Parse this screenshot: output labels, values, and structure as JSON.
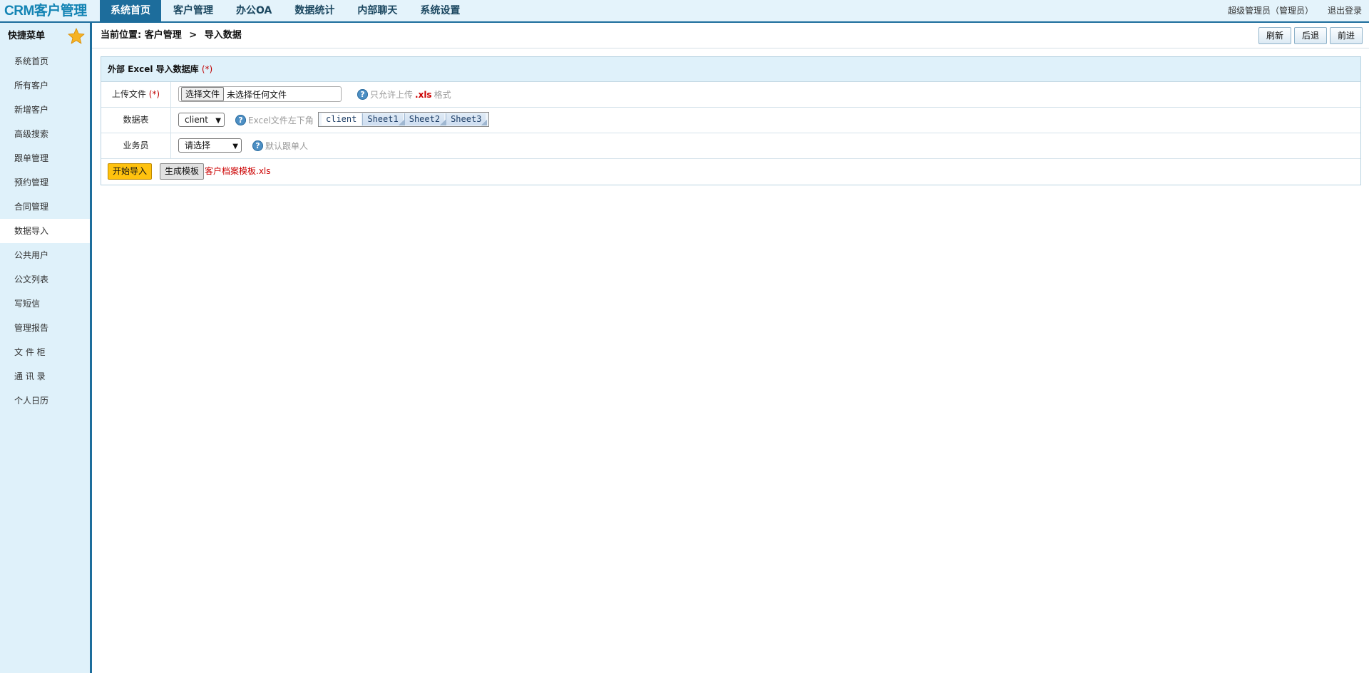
{
  "app": {
    "logo": "CRM客户管理"
  },
  "nav": {
    "tabs": [
      {
        "label": "系统首页",
        "active": true
      },
      {
        "label": "客户管理",
        "active": false
      },
      {
        "label": "办公OA",
        "active": false
      },
      {
        "label": "数据统计",
        "active": false
      },
      {
        "label": "内部聊天",
        "active": false
      },
      {
        "label": "系统设置",
        "active": false
      }
    ]
  },
  "user": {
    "name": "超级管理员（管理员）",
    "logout": "退出登录"
  },
  "sidebar": {
    "title": "快捷菜单",
    "items": [
      {
        "label": "系统首页",
        "active": false
      },
      {
        "label": "所有客户",
        "active": false
      },
      {
        "label": "新增客户",
        "active": false
      },
      {
        "label": "高级搜索",
        "active": false
      },
      {
        "label": "跟单管理",
        "active": false
      },
      {
        "label": "预约管理",
        "active": false
      },
      {
        "label": "合同管理",
        "active": false
      },
      {
        "label": "数据导入",
        "active": true
      },
      {
        "label": "公共用户",
        "active": false
      },
      {
        "label": "公文列表",
        "active": false
      },
      {
        "label": "写短信",
        "active": false
      },
      {
        "label": "管理报告",
        "active": false
      },
      {
        "label": "文 件 柜",
        "active": false
      },
      {
        "label": "通 讯 录",
        "active": false
      },
      {
        "label": "个人日历",
        "active": false
      }
    ]
  },
  "breadcrumb": {
    "prefix": "当前位置:",
    "section": "客户管理",
    "separator": ">",
    "page": "导入数据"
  },
  "toolbar": {
    "refresh": "刷新",
    "back": "后退",
    "forward": "前进"
  },
  "panel": {
    "title": "外部 Excel 导入数据库",
    "required_mark": "(*)",
    "upload": {
      "label": "上传文件",
      "required_mark": "(*)",
      "choose_button": "选择文件",
      "file_name": "未选择任何文件",
      "help_prefix": "只允许上传",
      "help_ext": ".xls",
      "help_suffix": "格式"
    },
    "table": {
      "label": "数据表",
      "selected": "client",
      "help": "Excel文件左下角",
      "sheets": [
        "client",
        "Sheet1",
        "Sheet2",
        "Sheet3"
      ]
    },
    "salesperson": {
      "label": "业务员",
      "selected": "请选择",
      "help": "默认跟单人"
    },
    "actions": {
      "import": "开始导入",
      "template": "生成模板",
      "template_file": "客户档案模板.xls"
    }
  },
  "colors": {
    "accent": "#1d6d9c",
    "sidebar_bg": "#dff1fa",
    "import_button": "#ffc20e",
    "required": "#cc0000"
  }
}
